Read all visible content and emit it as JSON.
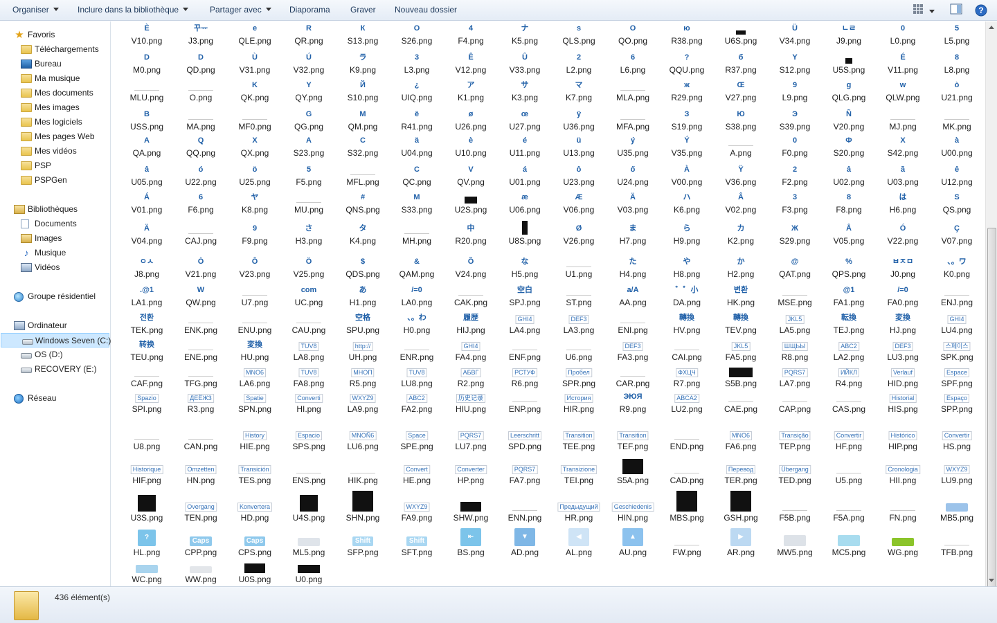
{
  "toolbar": {
    "organize": "Organiser",
    "include_library": "Inclure dans la bibliothèque",
    "share_with": "Partager avec",
    "slideshow": "Diaporama",
    "burn": "Graver",
    "new_folder": "Nouveau dossier"
  },
  "nav": {
    "favorites": "Favoris",
    "fav_items": [
      "Téléchargements",
      "Bureau",
      "Ma musique",
      "Mes documents",
      "Mes images",
      "Mes logiciels",
      "Mes pages Web",
      "Mes vidéos",
      "PSP",
      "PSPGen"
    ],
    "libraries": "Bibliothèques",
    "lib_items": [
      "Documents",
      "Images",
      "Musique",
      "Vidéos"
    ],
    "homegroup": "Groupe résidentiel",
    "computer": "Ordinateur",
    "drives": [
      "Windows Seven (C:)",
      "OS (D:)",
      "RECOVERY (E:)"
    ],
    "network": "Réseau"
  },
  "files": [
    [
      "V10.png",
      "J3.png",
      "QLE.png",
      "QR.png",
      "S13.png",
      "S26.png",
      "F4.png",
      "K5.png",
      "QLS.png",
      "QO.png",
      "R38.png",
      "U6S.png",
      "V34.png",
      "J9.png",
      "L0.png",
      "L5.png"
    ],
    [
      "M0.png",
      "QD.png",
      "V31.png",
      "V32.png",
      "K9.png",
      "L3.png",
      "V12.png",
      "V33.png",
      "L2.png",
      "L6.png",
      "QQU.png",
      "R37.png",
      "S12.png",
      "U5S.png",
      "V11.png",
      "L8.png"
    ],
    [
      "MLU.png",
      "O.png",
      "QK.png",
      "QY.png",
      "S10.png",
      "UIQ.png",
      "K1.png",
      "K3.png",
      "K7.png",
      "MLA.png",
      "R29.png",
      "V27.png",
      "L9.png",
      "QLG.png",
      "QLW.png",
      "U21.png"
    ],
    [
      "USS.png",
      "MA.png",
      "MF0.png",
      "QG.png",
      "QM.png",
      "R41.png",
      "U26.png",
      "U27.png",
      "U36.png",
      "MFA.png",
      "S19.png",
      "S38.png",
      "S39.png",
      "V20.png",
      "MJ.png",
      "MK.png"
    ],
    [
      "QA.png",
      "QQ.png",
      "QX.png",
      "S23.png",
      "S32.png",
      "U04.png",
      "U10.png",
      "U11.png",
      "U13.png",
      "U35.png",
      "V35.png",
      "A.png",
      "F0.png",
      "S20.png",
      "S42.png",
      "U00.png"
    ],
    [
      "U05.png",
      "U22.png",
      "U25.png",
      "F5.png",
      "MFL.png",
      "QC.png",
      "QV.png",
      "U01.png",
      "U23.png",
      "U24.png",
      "V00.png",
      "V36.png",
      "F2.png",
      "U02.png",
      "U03.png",
      "U12.png"
    ],
    [
      "V01.png",
      "F6.png",
      "K8.png",
      "MU.png",
      "QNS.png",
      "S33.png",
      "U2S.png",
      "U06.png",
      "V06.png",
      "V03.png",
      "K6.png",
      "V02.png",
      "F3.png",
      "F8.png",
      "H6.png",
      "QS.png"
    ],
    [
      "V04.png",
      "CAJ.png",
      "F9.png",
      "H3.png",
      "K4.png",
      "MH.png",
      "R20.png",
      "U8S.png",
      "V26.png",
      "H7.png",
      "H9.png",
      "K2.png",
      "S29.png",
      "V05.png",
      "V22.png",
      "V07.png"
    ],
    [
      "J8.png",
      "V21.png",
      "V23.png",
      "V25.png",
      "QDS.png",
      "QAM.png",
      "V24.png",
      "H5.png",
      "U1.png",
      "H4.png",
      "H8.png",
      "H2.png",
      "QAT.png",
      "QPS.png",
      "J0.png",
      "K0.png"
    ],
    [
      "LA1.png",
      "QW.png",
      "U7.png",
      "UC.png",
      "H1.png",
      "LA0.png",
      "CAK.png",
      "SPJ.png",
      "ST.png",
      "AA.png",
      "DA.png",
      "HK.png",
      "MSE.png",
      "FA1.png",
      "FA0.png",
      "ENJ.png"
    ],
    [
      "TEK.png",
      "ENK.png",
      "ENU.png",
      "CAU.png",
      "SPU.png",
      "H0.png",
      "HIJ.png",
      "LA4.png",
      "LA3.png",
      "ENI.png",
      "HV.png",
      "TEV.png",
      "LA5.png",
      "TEJ.png",
      "HJ.png",
      "LU4.png"
    ],
    [
      "TEU.png",
      "ENE.png",
      "HU.png",
      "LA8.png",
      "UH.png",
      "ENR.png",
      "FA4.png",
      "ENF.png",
      "U6.png",
      "FA3.png",
      "CAI.png",
      "FA5.png",
      "R8.png",
      "LA2.png",
      "LU3.png",
      "SPK.png"
    ],
    [
      "CAF.png",
      "TFG.png",
      "LA6.png",
      "FA8.png",
      "R5.png",
      "LU8.png",
      "R2.png",
      "R6.png",
      "SPR.png",
      "CAR.png",
      "R7.png",
      "S5B.png",
      "LA7.png",
      "R4.png",
      "HID.png",
      "SPF.png"
    ],
    [
      "SPI.png",
      "R3.png",
      "SPN.png",
      "HI.png",
      "LA9.png",
      "FA2.png",
      "HIU.png",
      "ENP.png",
      "HIR.png",
      "R9.png",
      "LU2.png",
      "CAE.png",
      "CAP.png",
      "CAS.png",
      "HIS.png",
      "SPP.png"
    ],
    [
      "U8.png",
      "CAN.png",
      "HIE.png",
      "SPS.png",
      "LU6.png",
      "SPE.png",
      "LU7.png",
      "SPD.png",
      "TEE.png",
      "TEF.png",
      "END.png",
      "FA6.png",
      "TEP.png",
      "HF.png",
      "HIP.png",
      "HS.png"
    ],
    [
      "HIF.png",
      "HN.png",
      "TES.png",
      "ENS.png",
      "HIK.png",
      "HE.png",
      "HP.png",
      "FA7.png",
      "TEI.png",
      "S5A.png",
      "CAD.png",
      "TER.png",
      "TED.png",
      "U5.png",
      "HII.png",
      "LU9.png"
    ],
    [
      "U3S.png",
      "TEN.png",
      "HD.png",
      "U4S.png",
      "SHN.png",
      "FA9.png",
      "SHW.png",
      "ENN.png",
      "HR.png",
      "HIN.png",
      "MBS.png",
      "GSH.png",
      "F5B.png",
      "F5A.png",
      "FN.png",
      "MB5.png"
    ],
    [
      "HL.png",
      "CPP.png",
      "CPS.png",
      "ML5.png",
      "SFP.png",
      "SFT.png",
      "BS.png",
      "AD.png",
      "AL.png",
      "AU.png",
      "FW.png",
      "AR.png",
      "MW5.png",
      "MC5.png",
      "WG.png",
      "TFB.png"
    ],
    [
      "WC.png",
      "WW.png",
      "U0S.png",
      "U0.png"
    ]
  ],
  "thumbs": [
    [
      "È",
      "꾸ᅲ",
      "e",
      "R",
      "К",
      "O",
      "4",
      "ナ",
      "s",
      "O",
      "ю",
      "",
      "Ü",
      "ㄴㄹ",
      "0",
      "5"
    ],
    [
      "D",
      "D",
      "Ù",
      "Ú",
      "ラ",
      "3",
      "Ê",
      "Û",
      "2",
      "6",
      "?",
      "б",
      "Y",
      "",
      "É",
      "8"
    ],
    [
      "",
      "",
      "K",
      "Y",
      "Й",
      "¿",
      "ア",
      "サ",
      "マ",
      "",
      "ж",
      "Œ",
      "9",
      "g",
      "w",
      "ò"
    ],
    [
      "В",
      "",
      "",
      "G",
      "M",
      "ё",
      "ø",
      "œ",
      "ÿ",
      "",
      "З",
      "Ю",
      "Э",
      "Ñ",
      "",
      ""
    ],
    [
      "A",
      "Q",
      "X",
      "A",
      "C",
      "ä",
      "è",
      "é",
      "ü",
      "ý",
      "Ý",
      "",
      "0",
      "Ф",
      "X",
      "à"
    ],
    [
      "â",
      "ó",
      "ö",
      "5",
      "",
      "C",
      "V",
      "á",
      "ô",
      "ő",
      "À",
      "Ÿ",
      "2",
      "â",
      "ã",
      "ê"
    ],
    [
      "Á",
      "6",
      "ヤ",
      "",
      "#",
      "M",
      "",
      "æ",
      "Æ",
      "Ä",
      "ハ",
      "Â",
      "3",
      "8",
      "は",
      "S"
    ],
    [
      "Ä",
      "",
      "9",
      "さ",
      "タ",
      "",
      "中",
      "",
      "Ø",
      "ま",
      "ら",
      "カ",
      "Ж",
      "Å",
      "Ó",
      "Ç"
    ],
    [
      "ㅇㅅ",
      "Ò",
      "Ô",
      "Ö",
      "$",
      "&",
      "Õ",
      "な",
      "",
      "た",
      "や",
      "か",
      "@",
      "%",
      "ㅂㅈㅁ",
      "、。ワ"
    ],
    [
      ".@1",
      "W",
      "",
      "com",
      "あ",
      "/=0",
      "",
      "空白",
      "",
      "a/A",
      "゛゜小",
      "변환",
      "",
      "@1",
      "/=0",
      ""
    ],
    [
      "전환",
      "",
      "",
      "",
      "空格",
      "、。わ",
      "履歴",
      "GHI4",
      "DEF3",
      "",
      "轉換",
      "轉換",
      "JKL5",
      "転換",
      "変換",
      "GHI4"
    ],
    [
      "转换",
      "",
      "変換",
      "TUV8",
      "http://",
      "",
      "GHI4",
      "",
      "",
      "DEF3",
      "",
      "JKL5",
      "ШЩЬЫ",
      "ABC2",
      "DEF3",
      "스페이스"
    ],
    [
      "",
      "",
      "MNO6",
      "TUV8",
      "МНОП",
      "TUV8",
      "АБВГ",
      "РСТУФ",
      "Пробел",
      "",
      "ФХЦЧ",
      "",
      "PQRS7",
      "ИЙКЛ",
      "Verlauf",
      "Espace"
    ],
    [
      "Spazio",
      "ДЕЁЖЗ",
      "Spatie",
      "Converti",
      "WXYZ9",
      "ABC2",
      "历史记录",
      "",
      "История",
      "ЭЮЯ",
      "ABCA2",
      "",
      "",
      "",
      "Historial",
      "Espaço"
    ],
    [
      "",
      "",
      "History",
      "Espacio",
      "MNOÑ6",
      "Space",
      "PQRS7",
      "Leerschritt",
      "Transition",
      "Transition",
      "",
      "MNO6",
      "Transição",
      "Convertir",
      "Histórico",
      "Convertir"
    ],
    [
      "Historique",
      "Omzetten",
      "Transición",
      "",
      "",
      "Convert",
      "Converter",
      "PQRS7",
      "Transizione",
      "",
      "",
      "Перевод",
      "Übergang",
      "",
      "Cronologia",
      "WXYZ9"
    ],
    [
      "",
      "Overgang",
      "Konvertera",
      "",
      "",
      "WXYZ9",
      "",
      "",
      "Предыдущий",
      "Geschiedenis",
      "",
      "",
      "",
      "",
      "",
      ""
    ],
    [
      "?",
      "Caps",
      "Caps",
      "",
      "Shift",
      "Shift",
      "⇤",
      "▼",
      "◀",
      "▲",
      "",
      "▶",
      "",
      "",
      "",
      ""
    ],
    [
      "",
      "",
      "",
      ""
    ]
  ],
  "status": {
    "count": "436 élément(s)"
  }
}
